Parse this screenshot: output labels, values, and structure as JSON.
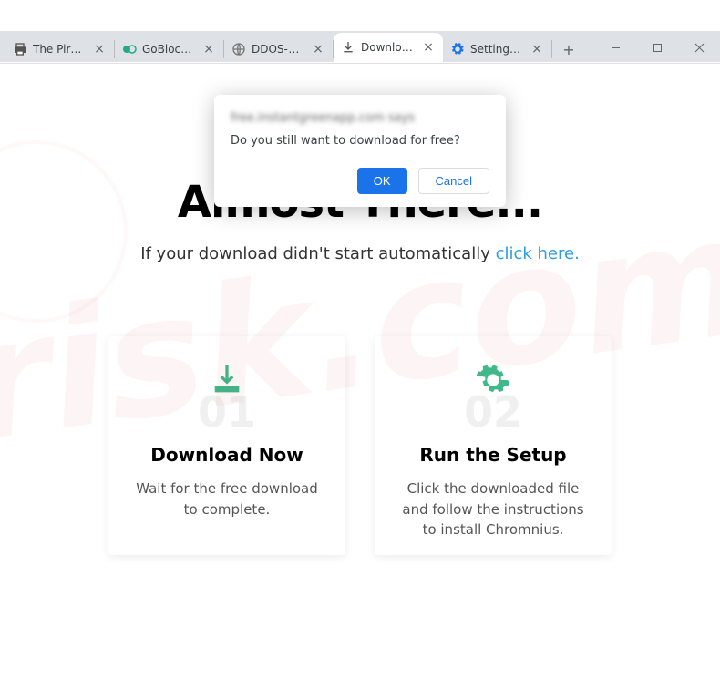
{
  "tabs": [
    {
      "title": "The Pirate Bay - T",
      "favicon": "printer"
    },
    {
      "title": "GoBlocker",
      "favicon": "goblocker"
    },
    {
      "title": "DDOS-GUARD",
      "favicon": "globe"
    },
    {
      "title": "Download Ready",
      "favicon": "download",
      "active": true
    },
    {
      "title": "Settings - Notific",
      "favicon": "settings"
    }
  ],
  "dialog": {
    "origin": "free.instantgreenapp.com says",
    "message": "Do you still want to download for free?",
    "ok": "OK",
    "cancel": "Cancel"
  },
  "page": {
    "title": "Almost There...",
    "subtitle_prefix": "If your download didn't start automatically ",
    "subtitle_link": "click here.",
    "cards": [
      {
        "num": "01",
        "title": "Download Now",
        "desc": "Wait for the free download to complete."
      },
      {
        "num": "02",
        "title": "Run the Setup",
        "desc": "Click the downloaded file and follow the instructions to install Chromnius."
      }
    ]
  },
  "omnibox": {
    "url": ""
  }
}
